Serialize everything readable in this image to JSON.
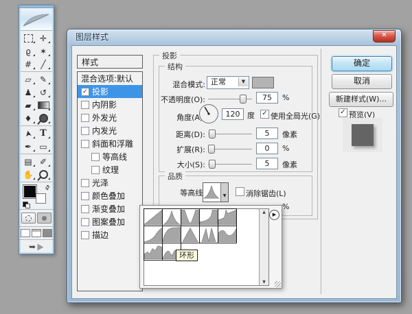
{
  "icons": {
    "close": "✕",
    "dropdown_arrow": "▼",
    "flyout_arrow": "▶",
    "scroll_up": "▲",
    "scroll_down": "▼",
    "check": "✓",
    "swap_arrows": "⇄",
    "jump_arrow": "➥"
  },
  "toolbar": {
    "tools": [
      {
        "name": "rectangular-marquee",
        "glyph": ""
      },
      {
        "name": "move",
        "glyph": "✛"
      },
      {
        "name": "lasso",
        "glyph": "ϱ"
      },
      {
        "name": "magic-wand",
        "glyph": "✶"
      },
      {
        "name": "crop",
        "glyph": "#"
      },
      {
        "name": "slice",
        "glyph": "╱"
      },
      {
        "name": "healing-brush",
        "glyph": "▱"
      },
      {
        "name": "brush",
        "glyph": "✎"
      },
      {
        "name": "clone-stamp",
        "glyph": "♟"
      },
      {
        "name": "history-brush",
        "glyph": "↺"
      },
      {
        "name": "eraser",
        "glyph": "▰"
      },
      {
        "name": "gradient",
        "glyph": ""
      },
      {
        "name": "blur",
        "glyph": "♦"
      },
      {
        "name": "dodge",
        "glyph": ""
      },
      {
        "name": "path-selection",
        "glyph": "➤"
      },
      {
        "name": "type",
        "glyph": "T"
      },
      {
        "name": "pen",
        "glyph": "✒"
      },
      {
        "name": "shape",
        "glyph": "▭"
      },
      {
        "name": "notes",
        "glyph": "▤"
      },
      {
        "name": "eyedropper",
        "glyph": "✐"
      },
      {
        "name": "hand",
        "glyph": "✋"
      },
      {
        "name": "zoom",
        "glyph": ""
      }
    ]
  },
  "dialog": {
    "title": "图层样式",
    "styles_panel": {
      "header": "样式",
      "items": [
        {
          "label": "混合选项:默认",
          "checkbox": false
        },
        {
          "label": "投影",
          "checkbox": true,
          "checked": true,
          "selected": true
        },
        {
          "label": "内阴影",
          "checkbox": true,
          "checked": false
        },
        {
          "label": "外发光",
          "checkbox": true,
          "checked": false
        },
        {
          "label": "内发光",
          "checkbox": true,
          "checked": false
        },
        {
          "label": "斜面和浮雕",
          "checkbox": true,
          "checked": false
        },
        {
          "label": "等高线",
          "checkbox": true,
          "checked": false,
          "indent": true
        },
        {
          "label": "纹理",
          "checkbox": true,
          "checked": false,
          "indent": true
        },
        {
          "label": "光泽",
          "checkbox": true,
          "checked": false
        },
        {
          "label": "颜色叠加",
          "checkbox": true,
          "checked": false
        },
        {
          "label": "渐变叠加",
          "checkbox": true,
          "checked": false
        },
        {
          "label": "图案叠加",
          "checkbox": true,
          "checked": false
        },
        {
          "label": "描边",
          "checkbox": true,
          "checked": false
        }
      ]
    },
    "panel": {
      "group": "投影",
      "structure": {
        "title": "结构",
        "blend_mode": {
          "label": "混合模式:",
          "value": "正常"
        },
        "opacity": {
          "label": "不透明度(O):",
          "value": "75",
          "unit": "%"
        },
        "angle": {
          "label": "角度(A):",
          "value": "120",
          "unit": "度"
        },
        "global_light": {
          "label": "使用全局光(G)",
          "checked": true
        },
        "distance": {
          "label": "距离(D):",
          "value": "5",
          "unit": "像素"
        },
        "spread": {
          "label": "扩展(R):",
          "value": "0",
          "unit": "%"
        },
        "size": {
          "label": "大小(S):",
          "value": "5",
          "unit": "像素"
        }
      },
      "quality": {
        "title": "品质",
        "contour_label": "等高线:",
        "antialias": {
          "label": "消除锯齿(L)",
          "checked": false
        },
        "noise_unit": "%"
      }
    },
    "buttons": {
      "ok": "确定",
      "cancel": "取消",
      "new_style": "新建样式(W)...",
      "preview": "预览(V)",
      "preview_checked": true
    },
    "contour_popup": {
      "tooltip": "环形"
    }
  },
  "colors": {
    "desktop": "#a2a2a2",
    "selection_blue": "#3e95e8",
    "ok_button_blue": "#bfe3f5",
    "close_red": "#c0392b",
    "shadow_color_swatch": "#b4b4b4",
    "preview_square": "#646464"
  }
}
